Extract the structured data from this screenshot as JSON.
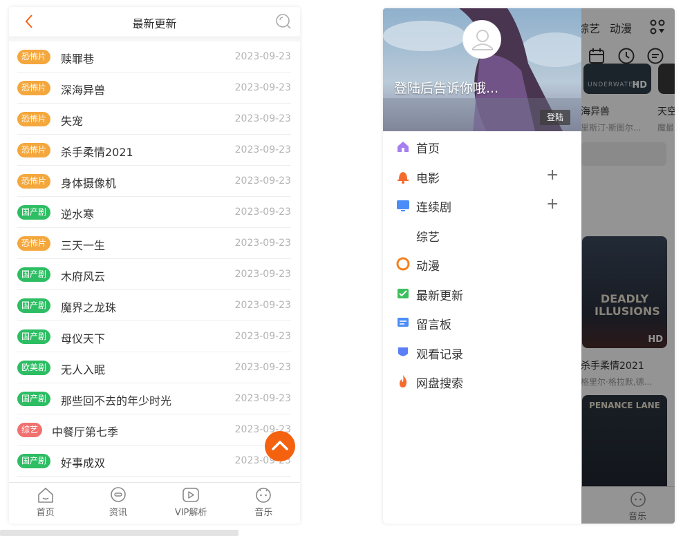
{
  "left_screen": {
    "title": "最新更新",
    "items": [
      {
        "tag": "恐怖片",
        "tag_color": "#f4a73c",
        "name": "赎罪巷",
        "date": "2023-09-23"
      },
      {
        "tag": "恐怖片",
        "tag_color": "#f4a73c",
        "name": "深海异兽",
        "date": "2023-09-23"
      },
      {
        "tag": "恐怖片",
        "tag_color": "#f4a73c",
        "name": "失宠",
        "date": "2023-09-23"
      },
      {
        "tag": "恐怖片",
        "tag_color": "#f4a73c",
        "name": "杀手柔情2021",
        "date": "2023-09-23"
      },
      {
        "tag": "恐怖片",
        "tag_color": "#f4a73c",
        "name": "身体摄像机",
        "date": "2023-09-23"
      },
      {
        "tag": "国产剧",
        "tag_color": "#2dbd63",
        "name": "逆水寒",
        "date": "2023-09-23"
      },
      {
        "tag": "恐怖片",
        "tag_color": "#f4a73c",
        "name": "三天一生",
        "date": "2023-09-23"
      },
      {
        "tag": "国产剧",
        "tag_color": "#2dbd63",
        "name": "木府风云",
        "date": "2023-09-23"
      },
      {
        "tag": "国产剧",
        "tag_color": "#2dbd63",
        "name": "魔界之龙珠",
        "date": "2023-09-23"
      },
      {
        "tag": "国产剧",
        "tag_color": "#2dbd63",
        "name": "母仪天下",
        "date": "2023-09-23"
      },
      {
        "tag": "欧美剧",
        "tag_color": "#2dbd63",
        "name": "无人入眠",
        "date": "2023-09-23"
      },
      {
        "tag": "国产剧",
        "tag_color": "#2dbd63",
        "name": "那些回不去的年少时光",
        "date": "2023-09-23"
      },
      {
        "tag": "综艺",
        "tag_color": "#f0716f",
        "name": "中餐厅第七季",
        "date": "2023-09-23"
      },
      {
        "tag": "国产剧",
        "tag_color": "#2dbd63",
        "name": "好事成双",
        "date": "2023-09-23"
      }
    ],
    "tabs": [
      {
        "label": "首页",
        "icon": "home-icon"
      },
      {
        "label": "资讯",
        "icon": "chat-icon"
      },
      {
        "label": "VIP解析",
        "icon": "play-icon"
      },
      {
        "label": "音乐",
        "icon": "face-icon"
      }
    ]
  },
  "right_screen": {
    "bg_nav": [
      "综艺",
      "动漫"
    ],
    "bg_movies": [
      {
        "title": "海异兽",
        "sub": "里斯汀·斯图尔..."
      },
      {
        "title": "天空",
        "sub": "魔最"
      },
      {
        "title": "杀手柔情2021",
        "sub": "格里尔·格拉默,德..."
      }
    ],
    "poster_badge": "HD",
    "poster_text_1": "UNDERWATER",
    "poster_text_2": "DEADLY ILLUSIONS",
    "poster_text_3": "PENANCE LANE",
    "bg_tab_label": "音乐",
    "drawer": {
      "hello": "登陆后告诉你哦...",
      "login_button": "登陆",
      "menu": [
        {
          "label": "首页",
          "icon": "home-icon",
          "color": "#a67ef0",
          "expandable": false
        },
        {
          "label": "电影",
          "icon": "bell-icon",
          "color": "#f56a2d",
          "expandable": true
        },
        {
          "label": "连续剧",
          "icon": "tv-icon",
          "color": "#4b8df8",
          "expandable": true
        },
        {
          "label": "综艺",
          "icon": "",
          "color": "",
          "expandable": false
        },
        {
          "label": "动漫",
          "icon": "ring-icon",
          "color": "#f5811f",
          "expandable": false
        },
        {
          "label": "最新更新",
          "icon": "check-icon",
          "color": "#3bbf5c",
          "expandable": false
        },
        {
          "label": "留言板",
          "icon": "board-icon",
          "color": "#4b8df8",
          "expandable": false
        },
        {
          "label": "观看记录",
          "icon": "shield-icon",
          "color": "#5b7ff5",
          "expandable": false
        },
        {
          "label": "网盘搜索",
          "icon": "flame-icon",
          "color": "#f56a2d",
          "expandable": false
        }
      ],
      "plus_glyph": "+"
    }
  }
}
